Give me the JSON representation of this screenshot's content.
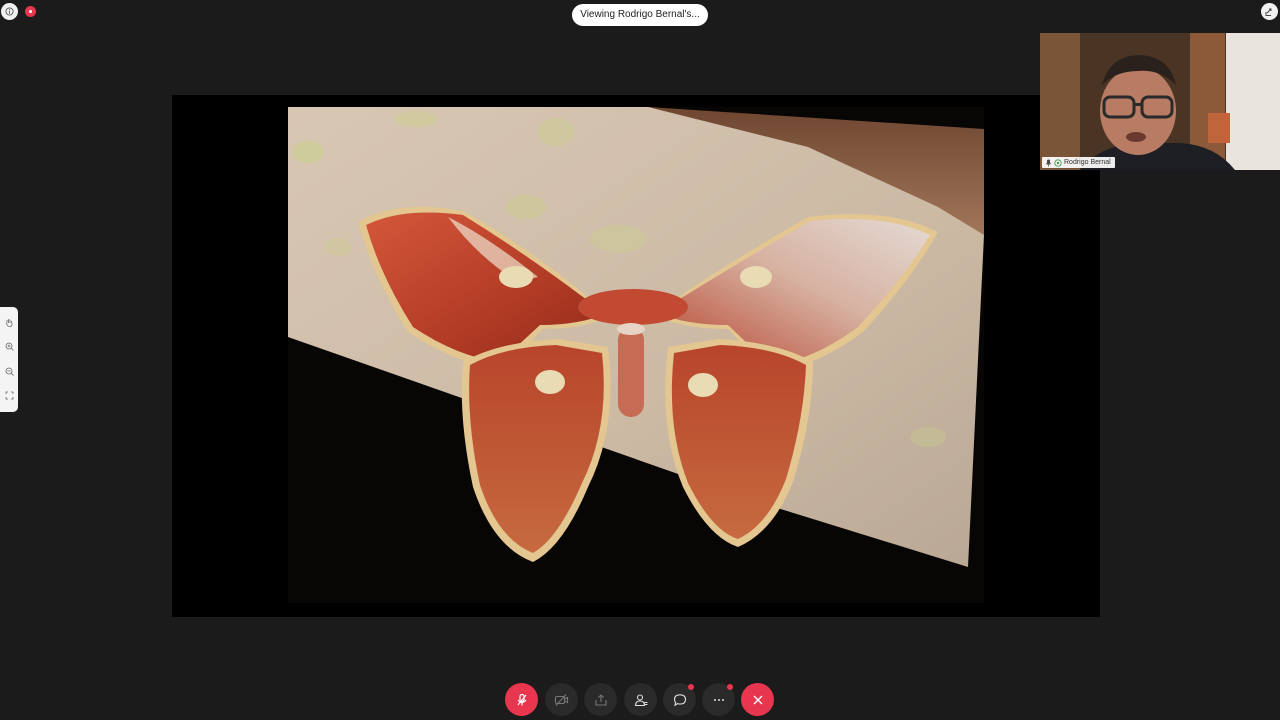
{
  "top_bar": {
    "info_icon": "info-icon",
    "recording_icon": "recording-indicator-icon",
    "viewing_label": "Viewing Rodrigo Bernal's...",
    "right_icon": "pop-out-icon"
  },
  "shared_screen": {
    "content": "photo-of-atlas-moth"
  },
  "video": {
    "participant_name": "Rodrigo Bernal",
    "mic_icon": "mic-on-icon",
    "signal_icon": "network-icon"
  },
  "zoom_controls": {
    "items": [
      "hand-icon",
      "zoom-in-icon",
      "zoom-out-icon",
      "fit-icon"
    ]
  },
  "controls": {
    "mute": "mute-icon",
    "video": "video-off-icon",
    "share": "share-icon",
    "participants": "participants-icon",
    "chat": "chat-icon",
    "more": "more-icon",
    "leave": "leave-icon"
  },
  "colors": {
    "accent": "#e8364f",
    "background": "#1b1b1b"
  }
}
